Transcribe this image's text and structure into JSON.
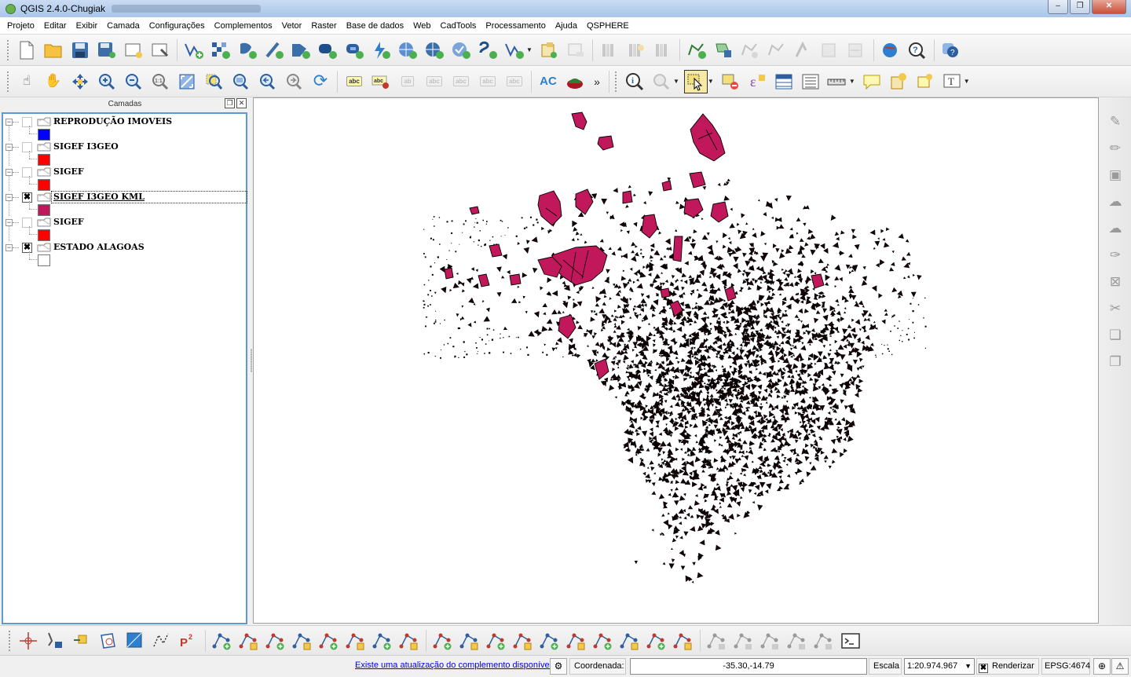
{
  "window": {
    "title": "QGIS 2.4.0-Chugiak",
    "min_glyph": "–",
    "max_glyph": "❐",
    "close_glyph": "✕"
  },
  "menu": [
    "Projeto",
    "Editar",
    "Exibir",
    "Camada",
    "Configurações",
    "Complementos",
    "Vetor",
    "Raster",
    "Base de dados",
    "Web",
    "CadTools",
    "Processamento",
    "Ajuda",
    "QSPHERE"
  ],
  "layers_panel": {
    "title": "Camadas",
    "float_glyph": "❐",
    "close_glyph": "✕",
    "layers": [
      {
        "name": "REPRODUÇÃO IMOVEIS",
        "checked": false,
        "color": "#0000ff",
        "check_glyph": ""
      },
      {
        "name": "SIGEF I3GEO",
        "checked": false,
        "color": "#ff0000",
        "check_glyph": ""
      },
      {
        "name": "SIGEF",
        "checked": false,
        "color": "#ff0000",
        "check_glyph": ""
      },
      {
        "name": "SIGEF I3GEO KML",
        "checked": true,
        "color": "#c0185a",
        "check_glyph": "✖"
      },
      {
        "name": "SIGEF",
        "checked": false,
        "color": "#ff0000",
        "check_glyph": ""
      },
      {
        "name": "ESTADO ALAGOAS",
        "checked": true,
        "color": "#ffffff",
        "check_glyph": "✖"
      }
    ]
  },
  "toolbar2": {
    "label_button": "AC",
    "more_glyph": "»"
  },
  "statusbar": {
    "update_link": "Existe uma atualização do complemento disponível",
    "coord_label": "Coordenada:",
    "coord_value": "-35.30,-14.79",
    "scale_label": "Escala",
    "scale_value": "1:20.974.967",
    "render_label": "Renderizar",
    "render_checked": true,
    "render_glyph": "✖",
    "crs": "EPSG:4674",
    "combo_arrow": "▼"
  },
  "colors": {
    "kml_fill": "#c0185a",
    "parcel_fill": "#1a0508",
    "selection_border": "#5b9bd5"
  }
}
